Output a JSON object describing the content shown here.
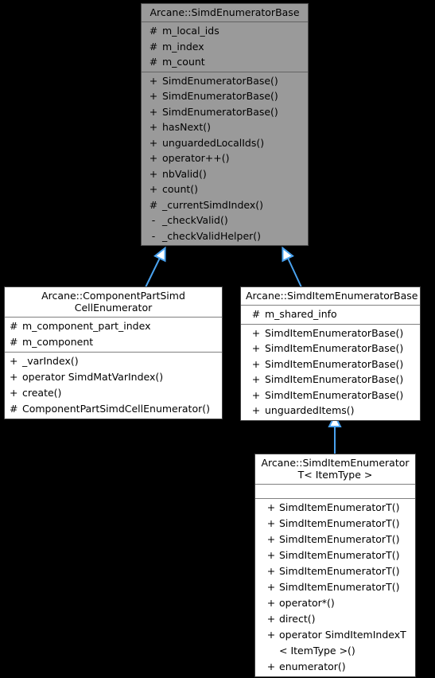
{
  "diagram": {
    "type": "uml-class-inheritance-graph",
    "background_color": "#000000",
    "edge_color": "#4aa3f0",
    "base_fill_color": "#9a9a9a",
    "derived_fill_color": "#ffffff"
  },
  "classes": {
    "simd_enumerator_base": {
      "title": "Arcane::SimdEnumeratorBase",
      "attributes": [
        {
          "visibility": "#",
          "name": "m_local_ids"
        },
        {
          "visibility": "#",
          "name": "m_index"
        },
        {
          "visibility": "#",
          "name": "m_count"
        }
      ],
      "operations": [
        {
          "visibility": "+",
          "name": "SimdEnumeratorBase()"
        },
        {
          "visibility": "+",
          "name": "SimdEnumeratorBase()"
        },
        {
          "visibility": "+",
          "name": "SimdEnumeratorBase()"
        },
        {
          "visibility": "+",
          "name": "hasNext()"
        },
        {
          "visibility": "+",
          "name": "unguardedLocalIds()"
        },
        {
          "visibility": "+",
          "name": "operator++()"
        },
        {
          "visibility": "+",
          "name": "nbValid()"
        },
        {
          "visibility": "+",
          "name": "count()"
        },
        {
          "visibility": "#",
          "name": "_currentSimdIndex()"
        },
        {
          "visibility": "-",
          "name": "_checkValid()"
        },
        {
          "visibility": "-",
          "name": "_checkValidHelper()"
        }
      ]
    },
    "component_part_simd_cell_enumerator": {
      "title": "Arcane::ComponentPartSimd\nCellEnumerator",
      "attributes": [
        {
          "visibility": "#",
          "name": "m_component_part_index"
        },
        {
          "visibility": "#",
          "name": "m_component"
        }
      ],
      "operations": [
        {
          "visibility": "+",
          "name": "_varIndex()"
        },
        {
          "visibility": "+",
          "name": "operator SimdMatVarIndex()"
        },
        {
          "visibility": "+",
          "name": "create()"
        },
        {
          "visibility": "#",
          "name": "ComponentPartSimdCellEnumerator()"
        }
      ]
    },
    "simd_item_enumerator_base": {
      "title": "Arcane::SimdItemEnumeratorBase",
      "attributes": [
        {
          "visibility": "#",
          "name": "m_shared_info"
        }
      ],
      "operations": [
        {
          "visibility": "+",
          "name": "SimdItemEnumeratorBase()"
        },
        {
          "visibility": "+",
          "name": "SimdItemEnumeratorBase()"
        },
        {
          "visibility": "+",
          "name": "SimdItemEnumeratorBase()"
        },
        {
          "visibility": "+",
          "name": "SimdItemEnumeratorBase()"
        },
        {
          "visibility": "+",
          "name": "SimdItemEnumeratorBase()"
        },
        {
          "visibility": "+",
          "name": "unguardedItems()"
        }
      ]
    },
    "simd_item_enumerator_t": {
      "title": "Arcane::SimdItemEnumerator\nT< ItemType >",
      "attributes": [],
      "operations": [
        {
          "visibility": "+",
          "name": "SimdItemEnumeratorT()"
        },
        {
          "visibility": "+",
          "name": "SimdItemEnumeratorT()"
        },
        {
          "visibility": "+",
          "name": "SimdItemEnumeratorT()"
        },
        {
          "visibility": "+",
          "name": "SimdItemEnumeratorT()"
        },
        {
          "visibility": "+",
          "name": "SimdItemEnumeratorT()"
        },
        {
          "visibility": "+",
          "name": "SimdItemEnumeratorT()"
        },
        {
          "visibility": "+",
          "name": "operator*()"
        },
        {
          "visibility": "+",
          "name": "direct()"
        },
        {
          "visibility": "+",
          "name": "operator SimdItemIndexT\n< ItemType >()"
        },
        {
          "visibility": "+",
          "name": "enumerator()"
        }
      ]
    }
  },
  "relations": [
    {
      "name": "componentpart-inherits-simdenumeratorbase",
      "from": "component_part_simd_cell_enumerator",
      "to": "simd_enumerator_base",
      "kind": "generalization"
    },
    {
      "name": "simditembase-inherits-simdenumeratorbase",
      "from": "simd_item_enumerator_base",
      "to": "simd_enumerator_base",
      "kind": "generalization"
    },
    {
      "name": "simditemt-inherits-simditembase",
      "from": "simd_item_enumerator_t",
      "to": "simd_item_enumerator_base",
      "kind": "generalization"
    }
  ]
}
